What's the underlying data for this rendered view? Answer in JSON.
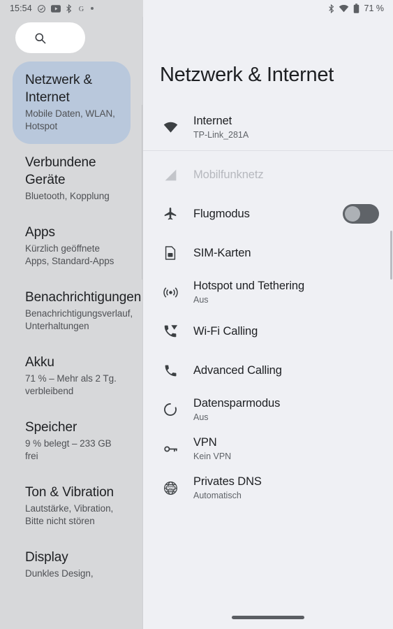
{
  "statusbar": {
    "time": "15:54",
    "left_icons": [
      "check-circle-icon",
      "video-icon",
      "bluetooth-icon",
      "google-icon",
      "dot-icon"
    ],
    "right_icons": [
      "bluetooth-icon",
      "wifi-icon",
      "battery-icon"
    ],
    "battery": "71 %"
  },
  "sidebar": {
    "search": {
      "icon": "search-icon",
      "placeholder": ""
    },
    "items": [
      {
        "title": "Netzwerk & Internet",
        "subtitle": "Mobile Daten, WLAN, Hotspot",
        "selected": true
      },
      {
        "title": "Verbundene Geräte",
        "subtitle": "Bluetooth, Kopplung",
        "selected": false
      },
      {
        "title": "Apps",
        "subtitle": "Kürzlich geöffnete Apps, Standard-Apps",
        "selected": false
      },
      {
        "title": "Benachrichtigungen",
        "subtitle": "Benachrichtigungsverlauf, Unterhaltungen",
        "selected": false
      },
      {
        "title": "Akku",
        "subtitle": "71 % – Mehr als 2 Tg. verbleibend",
        "selected": false
      },
      {
        "title": "Speicher",
        "subtitle": "9 % belegt – 233 GB frei",
        "selected": false
      },
      {
        "title": "Ton & Vibration",
        "subtitle": "Lautstärke, Vibration, Bitte nicht stören",
        "selected": false
      },
      {
        "title": "Display",
        "subtitle": "Dunkles Design,",
        "selected": false
      }
    ]
  },
  "main": {
    "title": "Netzwerk & Internet",
    "rows": [
      {
        "icon": "wifi-icon",
        "title": "Internet",
        "subtitle": "TP-Link_281A",
        "disabled": false,
        "toggle": null
      },
      {
        "icon": "signal-cellular-icon",
        "title": "Mobilfunknetz",
        "subtitle": "",
        "disabled": true,
        "toggle": null
      },
      {
        "icon": "airplane-icon",
        "title": "Flugmodus",
        "subtitle": "",
        "disabled": false,
        "toggle": "off"
      },
      {
        "icon": "sim-card-icon",
        "title": "SIM-Karten",
        "subtitle": "",
        "disabled": false,
        "toggle": null
      },
      {
        "icon": "hotspot-icon",
        "title": "Hotspot und Tethering",
        "subtitle": "Aus",
        "disabled": false,
        "toggle": null
      },
      {
        "icon": "wifi-calling-icon",
        "title": "Wi-Fi Calling",
        "subtitle": "",
        "disabled": false,
        "toggle": null
      },
      {
        "icon": "phone-icon",
        "title": "Advanced Calling",
        "subtitle": "",
        "disabled": false,
        "toggle": null
      },
      {
        "icon": "data-saver-icon",
        "title": "Datensparmodus",
        "subtitle": "Aus",
        "disabled": false,
        "toggle": null
      },
      {
        "icon": "key-icon",
        "title": "VPN",
        "subtitle": "Kein VPN",
        "disabled": false,
        "toggle": null
      },
      {
        "icon": "dns-globe-icon",
        "title": "Privates DNS",
        "subtitle": "Automatisch",
        "disabled": false,
        "toggle": null
      }
    ]
  },
  "colors": {
    "sidebar_bg": "#d7d8da",
    "main_bg": "#eff0f4",
    "selected_item_bg": "#b9c8dc",
    "toggle_track": "#5f6368",
    "toggle_knob": "#adb1b6"
  }
}
